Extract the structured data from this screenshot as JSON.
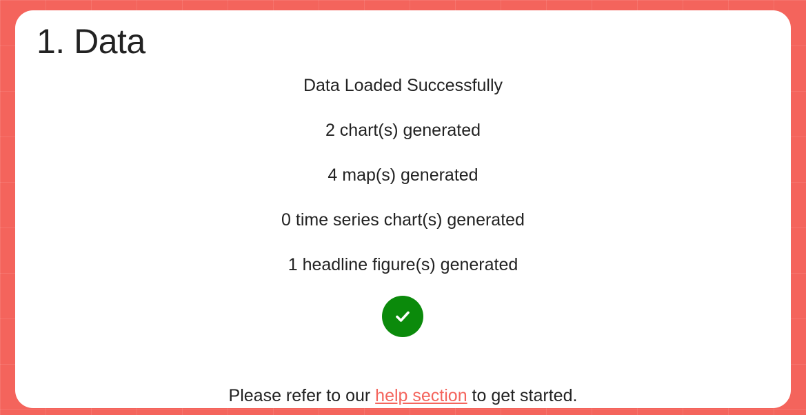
{
  "section": {
    "title": "1. Data"
  },
  "status": {
    "messages": [
      "Data Loaded Successfully",
      "2 chart(s) generated",
      "4 map(s) generated",
      "0 time series chart(s) generated",
      "1 headline figure(s) generated"
    ],
    "icon": "check-circle-icon",
    "icon_color": "#0b8a0b"
  },
  "footer": {
    "before_link": "Please refer to our ",
    "link_text": "help section",
    "after_link": " to get started."
  },
  "colors": {
    "background": "#f4645c",
    "card": "#ffffff",
    "link": "#f4645c"
  }
}
